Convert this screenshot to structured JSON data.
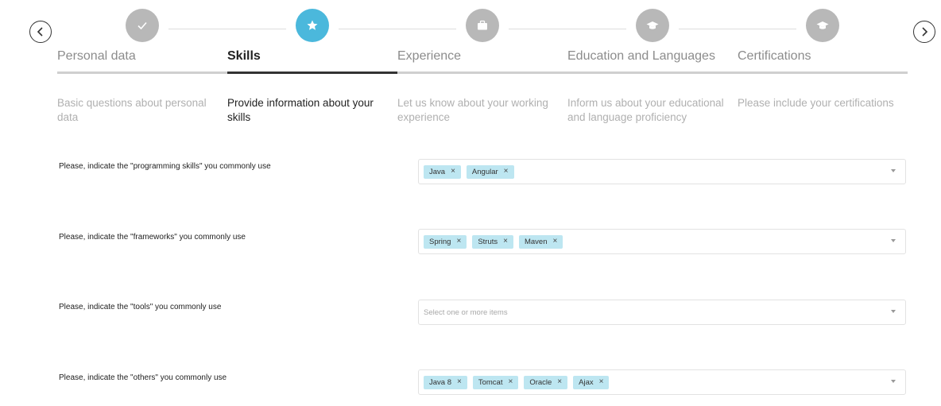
{
  "steps": [
    {
      "title": "Personal data",
      "description": "Basic questions about personal data",
      "icon": "check-icon",
      "state": "done"
    },
    {
      "title": "Skills",
      "description": "Provide information about your skills",
      "icon": "star-icon",
      "state": "active"
    },
    {
      "title": "Experience",
      "description": "Let us know about your working experience",
      "icon": "briefcase-icon",
      "state": "pending"
    },
    {
      "title": "Education and Languages",
      "description": "Inform us about your educational and language proficiency",
      "icon": "graduation-cap-icon",
      "state": "pending"
    },
    {
      "title": "Certifications",
      "description": "Please include your certifications",
      "icon": "graduation-cap-icon",
      "state": "pending"
    }
  ],
  "colors": {
    "active": "#4bb8dc",
    "inactive": "#b8b8b8",
    "tag": "#bde6f1"
  },
  "questions": [
    {
      "label": "Please, indicate the \"programming skills\" you commonly use",
      "tags": [
        "Java",
        "Angular"
      ],
      "placeholder": "Select one or more items"
    },
    {
      "label": "Please, indicate the \"frameworks\" you commonly use",
      "tags": [
        "Spring",
        "Struts",
        "Maven"
      ],
      "placeholder": "Select one or more items"
    },
    {
      "label": "Please, indicate the \"tools\" you commonly use",
      "tags": [],
      "placeholder": "Select one or more items"
    },
    {
      "label": "Please, indicate the \"others\" you commonly use",
      "tags": [
        "Java 8",
        "Tomcat",
        "Oracle",
        "Ajax"
      ],
      "placeholder": "Select one or more items"
    }
  ],
  "tag_remove_glyph": "×"
}
